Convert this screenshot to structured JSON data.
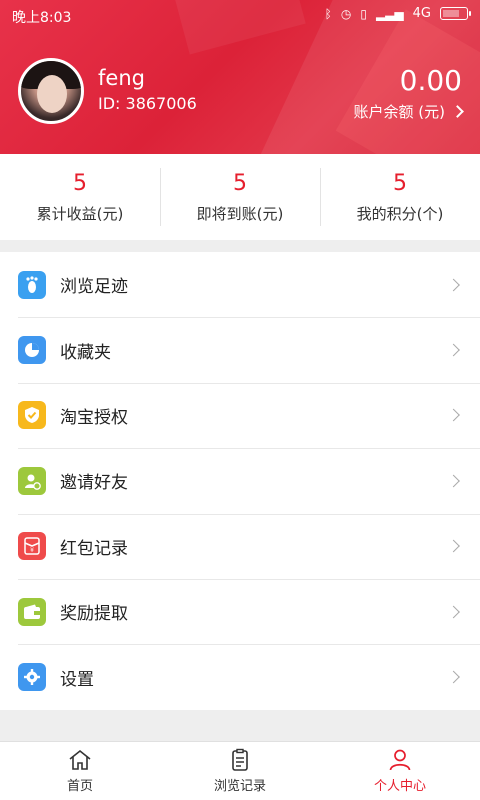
{
  "status_bar": {
    "time": "晚上8:03",
    "network": "4G"
  },
  "profile": {
    "username": "feng",
    "user_id": "ID: 3867006",
    "balance": "0.00",
    "balance_label": "账户余额 (元)"
  },
  "stats": [
    {
      "value": "5",
      "label": "累计收益(元)"
    },
    {
      "value": "5",
      "label": "即将到账(元)"
    },
    {
      "value": "5",
      "label": "我的积分(个)"
    }
  ],
  "menu": [
    {
      "label": "浏览足迹",
      "icon": "footprint-icon",
      "color": "#3aa0f0"
    },
    {
      "label": "收藏夹",
      "icon": "pie-chart-icon",
      "color": "#3f97ef"
    },
    {
      "label": "淘宝授权",
      "icon": "shield-check-icon",
      "color": "#f7b81c"
    },
    {
      "label": "邀请好友",
      "icon": "add-user-icon",
      "color": "#9dc83c"
    },
    {
      "label": "红包记录",
      "icon": "red-envelope-icon",
      "color": "#ef4b4b"
    },
    {
      "label": "奖励提取",
      "icon": "wallet-icon",
      "color": "#9dc83c"
    },
    {
      "label": "设置",
      "icon": "gear-icon",
      "color": "#3f97ef"
    }
  ],
  "bottom_nav": [
    {
      "label": "首页",
      "icon": "home-icon",
      "active": false
    },
    {
      "label": "浏览记录",
      "icon": "clipboard-icon",
      "active": false
    },
    {
      "label": "个人中心",
      "icon": "person-icon",
      "active": true
    }
  ],
  "colors": {
    "accent": "#e61e2d",
    "header": "#dc2238"
  }
}
